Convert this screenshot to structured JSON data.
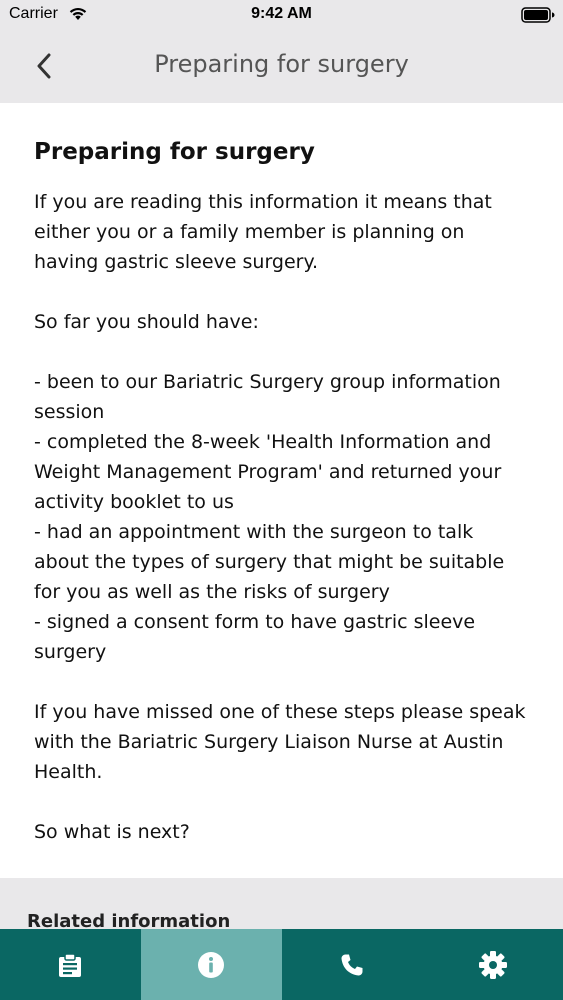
{
  "status_bar": {
    "carrier": "Carrier",
    "time": "9:42 AM"
  },
  "nav": {
    "title": "Preparing for surgery",
    "back_icon": "chevron-left-icon"
  },
  "content": {
    "title": "Preparing for surgery",
    "paragraphs": [
      "If you are reading this information it means that either you or a family member is planning on having gastric sleeve surgery.",
      "So far you should have:",
      "- been to our Bariatric Surgery group information session",
      "- completed the 8-week 'Health Information and Weight Management Program' and returned your activity booklet to us",
      "- had an appointment with the surgeon to talk about the types of surgery that might be suitable for you as well as the risks of surgery",
      "- signed a consent form to have gastric sleeve surgery",
      "If you have missed one of these steps please speak with the Bariatric Surgery Liaison Nurse at Austin Health.",
      "So what is next?"
    ]
  },
  "related": {
    "heading": "Related information"
  },
  "tab_bar": {
    "tabs": [
      {
        "icon": "clipboard-icon",
        "active": false
      },
      {
        "icon": "info-icon",
        "active": true
      },
      {
        "icon": "phone-icon",
        "active": false
      },
      {
        "icon": "gear-icon",
        "active": false
      }
    ]
  },
  "colors": {
    "tab_bar": "#0a6763",
    "tab_active": "#6bb1ae",
    "nav_background": "#e9e8ea",
    "content_background": "#ffffff"
  }
}
